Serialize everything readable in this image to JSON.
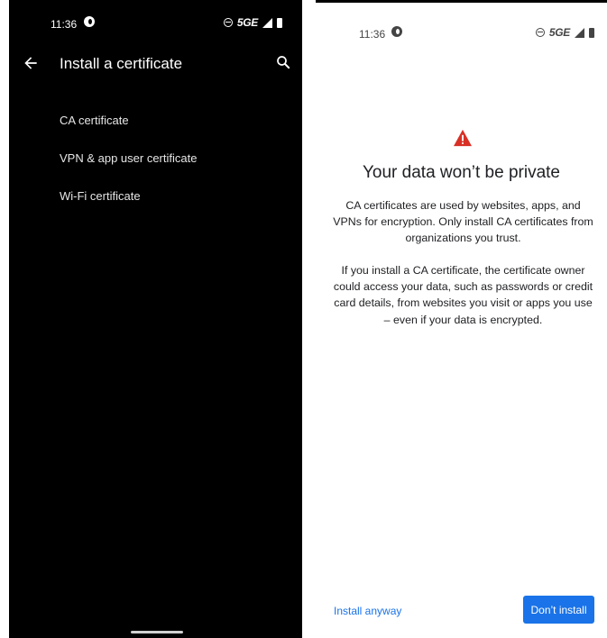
{
  "left_screen": {
    "status": {
      "time": "11:36",
      "network": "5GE"
    },
    "title": "Install a certificate",
    "items": [
      {
        "label": "CA certificate"
      },
      {
        "label": "VPN & app user certificate"
      },
      {
        "label": "Wi-Fi certificate"
      }
    ]
  },
  "right_screen": {
    "status": {
      "time": "11:36",
      "network": "5GE"
    },
    "heading": "Your data won’t be private",
    "paragraph1": "CA certificates are used by websites, apps, and VPNs for encryption. Only install CA certificates from organizations you trust.",
    "paragraph2": "If you install a CA certificate, the certificate owner could access your data, such as passwords or credit card details, from websites you visit or apps you use – even if your data is encrypted.",
    "install_anyway_label": "Install anyway",
    "dont_install_label": "Don’t install"
  },
  "colors": {
    "accent": "#1a73e8",
    "warning": "#d93025",
    "dark_bg": "#000000"
  }
}
